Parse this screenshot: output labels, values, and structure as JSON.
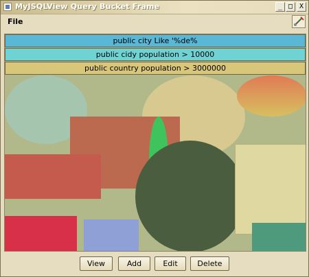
{
  "window": {
    "title": "MyJSQLView Query Bucket Frame",
    "controls": {
      "minimize": "_",
      "maximize": "□",
      "close": "X"
    }
  },
  "menu": {
    "file_label": "File",
    "right_icon": "plug-connect-icon"
  },
  "queries": [
    {
      "text": "public city Like '%de%",
      "color": "#5bb7d6"
    },
    {
      "text": "public cidy population > 10000",
      "color": "#6fd3d4"
    },
    {
      "text": "public country population > 3000000",
      "color": "#d8c67a"
    }
  ],
  "buttons": {
    "view": "View",
    "add": "Add",
    "edit": "Edit",
    "delete": "Delete"
  }
}
